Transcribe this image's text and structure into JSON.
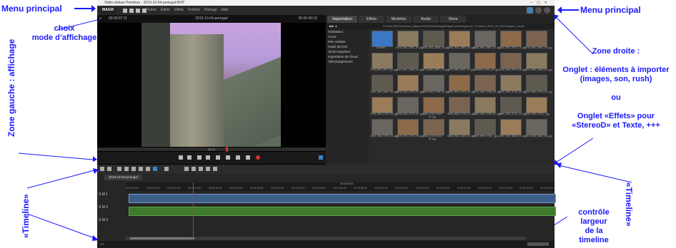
{
  "annotations": {
    "menu_left": "Menu principal",
    "display_mode": "choix\nmode d’affichage",
    "left_zone": "Zone gauche : affichage",
    "menu_right": "Menu principal",
    "right_zone": "Zone droite :\n\nOnglet : éléments à importer\n(images, son, rush)\n\nou\n\nOnglet «Effets» pour\n«StereoD» et Texte, +++",
    "timeline_left": "«Timeline»",
    "timeline_right": "«Timeline»",
    "width_control": "contrôle\nlargeur\nde la\ntimeline"
  },
  "app": {
    "title": "Vidéo deluxe Premium - 2019-10-04-portugal.MVP",
    "logo": "MAGIX",
    "menu": [
      "Fichier",
      "Éditer",
      "Effets",
      "Fenêtre",
      "Partage",
      "Aide"
    ],
    "preview": {
      "time_left": "00:00:07:11",
      "title": "2019-10-04-portugal",
      "time_right": "00:00:49:15",
      "scrub_label": "06:16"
    },
    "tabs": [
      "Importation",
      "Effets",
      "Modèles",
      "Audio",
      "Store"
    ],
    "active_tab": "Importation",
    "path": "D:\\Test-HDD\\Dossiers_Manuel\\2019\\10\\Montage\\Diaporama\\Pagaie de_Portocïs_2019_09_01\\Portugal_Centre",
    "sidebar": [
      "Ordinateur",
      "Accer",
      "Mes médias",
      "Outils MAGIX",
      "Send Anywhere",
      "Importation de Cloud",
      "Téléchargements"
    ],
    "first_thumb_label": "Evolutis",
    "thumb_labels": [
      "5020_IMG_3881_St..jpg",
      "5025_IMG_3858_St..jpg",
      "5040_IMG_3882_43..jpg",
      "5050_IMG_3880_31..jpg",
      "1115_IMG_3874_74..jpg",
      "1130_IMG_3887_26..jpg",
      "1135_IMG_3871_52..jpg",
      "1140_IMG_3863_04..jpg",
      "1170_IMG_3897_29..jpg",
      "1175_IMG_3847_11..jpg",
      "1180IMG_3914_41..jpg",
      "1195_IMG_3913_95..jpg",
      "1210_IMG_3965_09..jpg",
      "1300_IMG_3826_35..jpg",
      "3600_IMG_3794_07..jpg",
      "3680_IMG_3788_10..jpg",
      "3700_IMG_3794_45..jpg",
      "3710_IMG_3748_49..jpg",
      "3740_IMG_3792_33..jpg",
      "3720_IMG_3723_01..jpg",
      "3780_IMG_3722_24..jpg",
      "3790_IMG_3716_47..jpg",
      "3830_DSC07826 St..jpg",
      "3840_IMG_3719_21..jpg",
      "3860_IMG_3738_27..jpg",
      "3880_IMG_3711_12..jpg",
      "3905_IMG_3709_..jpg",
      "3940_IMG_3709_16..jpg",
      "5820_IMG_3756_06..jpg",
      "5830_DSC07830 St..jpg",
      "5880_IMG_3860_32..jpg",
      "5890_IMG_3798_..jpg",
      "6000_IMG_3803_St..jpg",
      "6010_IMG_3862_St..jpg"
    ],
    "timeline": {
      "project": "2019-10-04-portugal",
      "tracks": [
        "S M",
        "S M",
        "S M"
      ],
      "track_numbers": [
        "1",
        "2",
        "3"
      ],
      "ruler_center": "00:00:49:15",
      "ruler_ticks": [
        "00:00:00:00",
        "00:00:05:00",
        "00:00:10:00",
        "00:00:15:00",
        "00:00:20:00",
        "00:00:25:00",
        "00:00:30:00",
        "00:00:35:00",
        "00:00:40:00",
        "00:00:45:00",
        "00:00:50:00",
        "00:00:55:00",
        "00:01:00:00",
        "00:01:05:00",
        "00:01:10:00",
        "00:01:15:00",
        "00:01:20:00",
        "00:01:25:00",
        "00:01:30:00",
        "00:01:35:00",
        "00:01:40:00"
      ],
      "zoom": "0%"
    }
  },
  "colors": {
    "annotation": "#1a1aff",
    "accent": "#3a82c4",
    "record": "#d23232",
    "video_clip": "#3c5f8a",
    "audio_clip": "#3f7a2d"
  }
}
